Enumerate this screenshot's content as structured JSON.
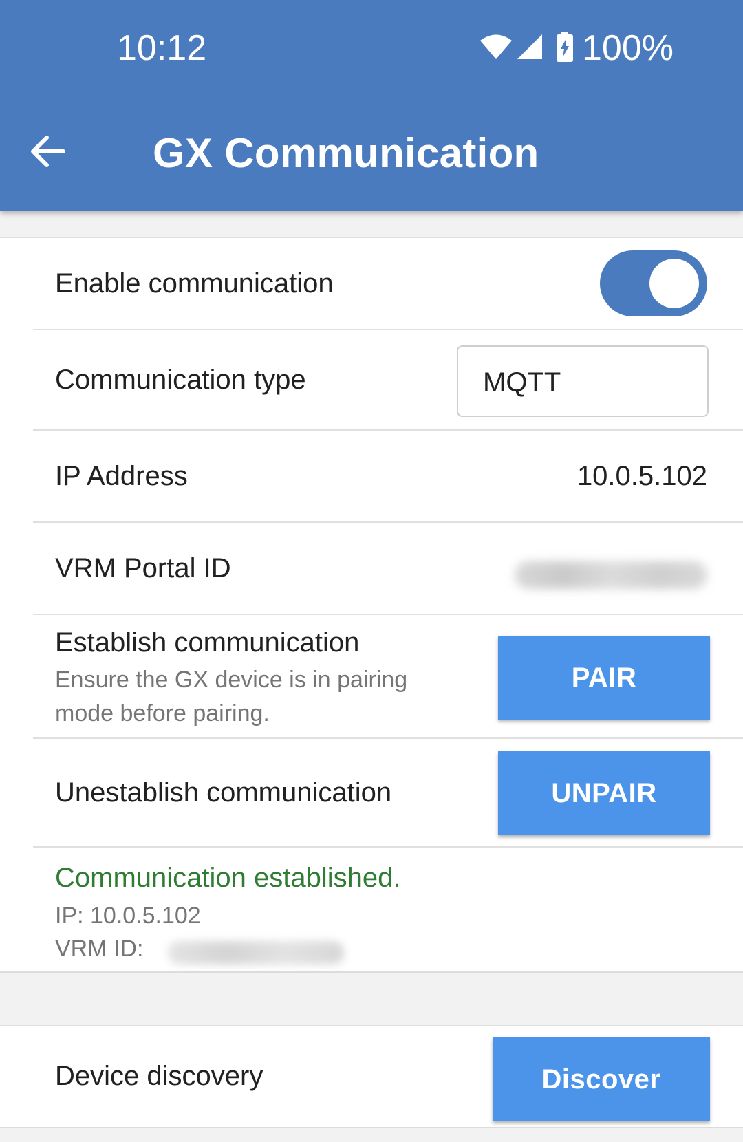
{
  "status_bar": {
    "time": "10:12",
    "battery": "100%",
    "icons": [
      "wifi-icon",
      "cell-signal-icon",
      "battery-charging-icon"
    ]
  },
  "toolbar": {
    "title": "GX Communication",
    "back_icon": "arrow-left-icon"
  },
  "settings": {
    "enable": {
      "label": "Enable communication",
      "on": true
    },
    "comm_type": {
      "label": "Communication type",
      "value": "MQTT"
    },
    "ip": {
      "label": "IP Address",
      "value": "10.0.5.102"
    },
    "vrm": {
      "label": "VRM Portal ID"
    },
    "establish": {
      "label": "Establish communication",
      "hint": "Ensure the GX device is in pairing mode before pairing.",
      "button": "PAIR"
    },
    "unestablish": {
      "label": "Unestablish communication",
      "button": "UNPAIR"
    },
    "status": {
      "message": "Communication established.",
      "ip_line": "IP: 10.0.5.102",
      "vrm_prefix": "VRM ID:"
    }
  },
  "discovery": {
    "label": "Device discovery",
    "button": "Discover"
  },
  "colors": {
    "app_bar": "#4a7bbf",
    "button": "#4c94ea",
    "success_text": "#2e7d32",
    "secondary_text": "#757575"
  }
}
